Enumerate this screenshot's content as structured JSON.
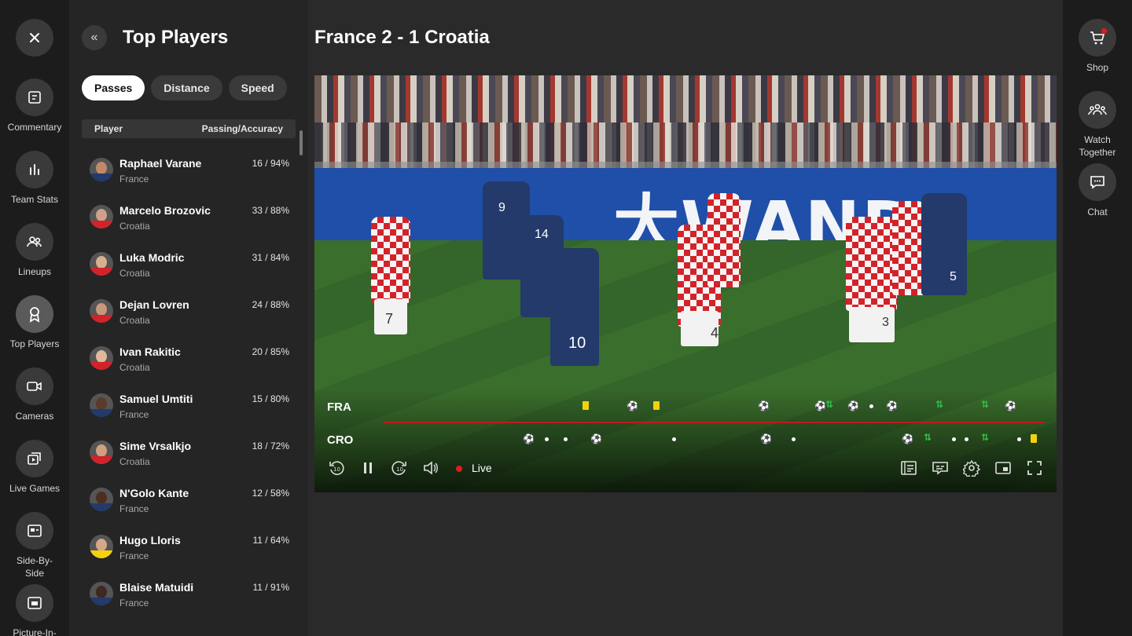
{
  "left_rail": {
    "items": [
      {
        "label": "Commentary",
        "icon": "commentary-icon"
      },
      {
        "label": "Team Stats",
        "icon": "bar-chart-icon"
      },
      {
        "label": "Lineups",
        "icon": "people-icon"
      },
      {
        "label": "Top Players",
        "icon": "award-icon"
      },
      {
        "label": "Cameras",
        "icon": "camera-icon"
      },
      {
        "label": "Live Games",
        "icon": "live-games-icon"
      },
      {
        "label": "Side-By-Side",
        "icon": "side-by-side-icon"
      },
      {
        "label": "Picture-In-",
        "icon": "picture-in-picture-icon"
      }
    ]
  },
  "panel": {
    "title": "Top Players",
    "tabs": [
      "Passes",
      "Distance",
      "Speed"
    ],
    "active_tab": "Passes",
    "columns": {
      "player": "Player",
      "stat": "Passing/Accuracy"
    },
    "players": [
      {
        "name": "Raphael Varane",
        "team": "France",
        "stat": "16 / 94%"
      },
      {
        "name": "Marcelo Brozovic",
        "team": "Croatia",
        "stat": "33 / 88%"
      },
      {
        "name": "Luka Modric",
        "team": "Croatia",
        "stat": "31 / 84%"
      },
      {
        "name": "Dejan Lovren",
        "team": "Croatia",
        "stat": "24 / 88%"
      },
      {
        "name": "Ivan Rakitic",
        "team": "Croatia",
        "stat": "20 / 85%"
      },
      {
        "name": "Samuel Umtiti",
        "team": "France",
        "stat": "15 / 80%"
      },
      {
        "name": "Sime Vrsalkjo",
        "team": "Croatia",
        "stat": "18 / 72%"
      },
      {
        "name": "N'Golo Kante",
        "team": "France",
        "stat": "12 / 58%"
      },
      {
        "name": "Hugo Lloris",
        "team": "France",
        "stat": "11 / 64%"
      },
      {
        "name": "Blaise Matuidi",
        "team": "France",
        "stat": "11 / 91%"
      }
    ]
  },
  "main": {
    "title": "France 2 - 1 Croatia",
    "video": {
      "board_text": "大WAND",
      "timeline": {
        "home": "FRA",
        "away": "CRO"
      },
      "live_label": "Live",
      "jersey_numbers": [
        "7",
        "9",
        "14",
        "10",
        "4",
        "3",
        "5"
      ]
    }
  },
  "right_rail": {
    "items": [
      {
        "label": "Shop",
        "icon": "cart-icon"
      },
      {
        "label": "Watch Together",
        "label_line1": "Watch",
        "label_line2": "Together",
        "icon": "group-icon"
      },
      {
        "label": "Chat",
        "icon": "chat-icon"
      }
    ]
  },
  "colors": {
    "accent_red": "#e01b1b",
    "croatia_red": "#d2232a",
    "france_blue": "#233a6a",
    "yellow_card": "#f2d20f"
  }
}
